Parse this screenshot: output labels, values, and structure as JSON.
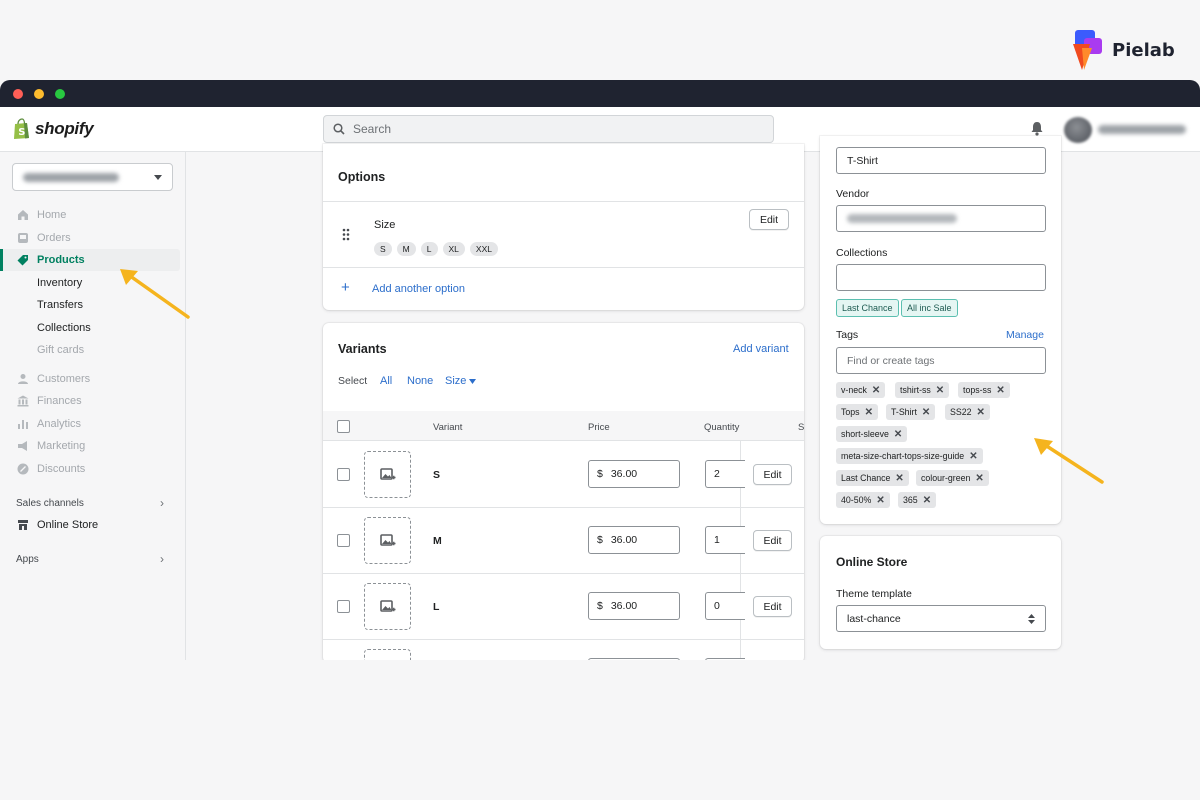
{
  "brand": {
    "name": "Pielab"
  },
  "topbar": {
    "logo_text": "shopify",
    "search_placeholder": "Search"
  },
  "sidebar": {
    "items": [
      {
        "label": "Home",
        "icon": "home-icon"
      },
      {
        "label": "Orders",
        "icon": "orders-icon"
      },
      {
        "label": "Products",
        "icon": "tag-icon"
      },
      {
        "label": "Inventory"
      },
      {
        "label": "Transfers"
      },
      {
        "label": "Collections"
      },
      {
        "label": "Gift cards"
      },
      {
        "label": "Customers",
        "icon": "person-icon"
      },
      {
        "label": "Finances",
        "icon": "bank-icon"
      },
      {
        "label": "Analytics",
        "icon": "bar-chart-icon"
      },
      {
        "label": "Marketing",
        "icon": "megaphone-icon"
      },
      {
        "label": "Discounts",
        "icon": "discount-icon"
      }
    ],
    "sales_channels_label": "Sales channels",
    "online_store_label": "Online Store",
    "apps_label": "Apps"
  },
  "options_card": {
    "title": "Options",
    "option_name": "Size",
    "values": [
      "S",
      "M",
      "L",
      "XL",
      "XXL"
    ],
    "edit_label": "Edit",
    "add_option_label": "Add another option"
  },
  "variants_card": {
    "title": "Variants",
    "add_variant_label": "Add variant",
    "select_label": "Select",
    "select_all": "All",
    "select_none": "None",
    "select_size": "Size",
    "columns": {
      "variant": "Variant",
      "price": "Price",
      "quantity": "Quantity",
      "sku": "S"
    },
    "rows": [
      {
        "variant": "S",
        "currency": "$",
        "price": "36.00",
        "quantity": "2",
        "edit": "Edit"
      },
      {
        "variant": "M",
        "currency": "$",
        "price": "36.00",
        "quantity": "1",
        "edit": "Edit"
      },
      {
        "variant": "L",
        "currency": "$",
        "price": "36.00",
        "quantity": "0",
        "edit": "Edit"
      }
    ]
  },
  "organization": {
    "product_type_value": "T-Shirt",
    "vendor_label": "Vendor",
    "collections_label": "Collections",
    "collections": [
      "Last Chance",
      "All inc Sale"
    ],
    "tags_label": "Tags",
    "manage_label": "Manage",
    "tags_placeholder": "Find or create tags",
    "tags": [
      "v-neck",
      "tshirt-ss",
      "tops-ss",
      "Tops",
      "T-Shirt",
      "SS22",
      "short-sleeve",
      "meta-size-chart-tops-size-guide",
      "Last Chance",
      "colour-green",
      "40-50%",
      "365"
    ]
  },
  "online_store": {
    "title": "Online Store",
    "theme_template_label": "Theme template",
    "theme_template_value": "last-chance"
  },
  "colors": {
    "accent_green": "#008060",
    "link_blue": "#2c6ecb",
    "arrow_orange": "#f5b41e",
    "titlebar": "#1f2330"
  }
}
